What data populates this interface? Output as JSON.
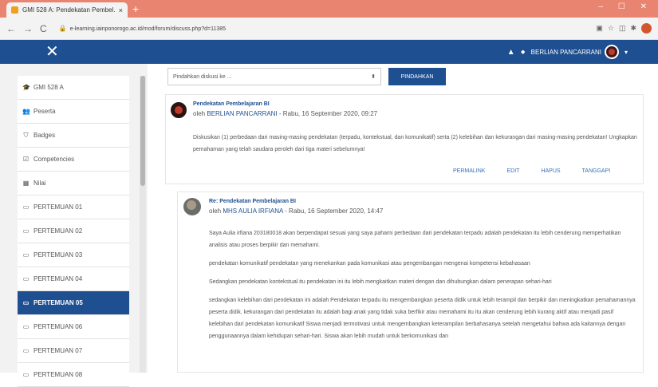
{
  "browser": {
    "tab_title": "GMI 528 A: Pendekatan Pembel...",
    "tab_close": "×",
    "new_tab": "+",
    "url": "e-learning.iainponorogo.ac.id/mod/forum/discuss.php?d=11385",
    "window_controls": "– ☐ ✕"
  },
  "navbar": {
    "menu_icon": "✕",
    "user_name": "BERLIAN PANCARRANI"
  },
  "sidebar": {
    "items": [
      {
        "label": "GMI 528 A",
        "icon": "mortarboard-icon"
      },
      {
        "label": "Peserta",
        "icon": "users-icon"
      },
      {
        "label": "Badges",
        "icon": "badge-icon"
      },
      {
        "label": "Competencies",
        "icon": "checklist-icon"
      },
      {
        "label": "Nilai",
        "icon": "table-icon"
      },
      {
        "label": "PERTEMUAN 01",
        "icon": "folder-icon"
      },
      {
        "label": "PERTEMUAN 02",
        "icon": "folder-icon"
      },
      {
        "label": "PERTEMUAN 03",
        "icon": "folder-icon"
      },
      {
        "label": "PERTEMUAN 04",
        "icon": "folder-icon"
      },
      {
        "label": "PERTEMUAN 05",
        "icon": "folder-icon",
        "active": true
      },
      {
        "label": "PERTEMUAN 06",
        "icon": "folder-icon"
      },
      {
        "label": "PERTEMUAN 07",
        "icon": "folder-icon"
      },
      {
        "label": "PERTEMUAN 08",
        "icon": "folder-icon"
      }
    ]
  },
  "move": {
    "select_value": "Pindahkan diskusi ke ...",
    "button": "PINDAHKAN"
  },
  "post1": {
    "subject": "Pendekatan Pembelajaran BI",
    "by": "oleh",
    "author": "BERLIAN PANCARRANI",
    "date": "- Rabu, 16 September 2020, 09:27",
    "body": "Diskusikan (1) perbedaan dari masing-masing pendekatan (terpadu, kontekstual, dan komunikatif) serta (2) kelebihan dan kekurangan dari masing-masing pendekatan! Ungkapkan pemahaman yang telah saudara peroleh dari tiga materi sebelumnya!",
    "actions": [
      "PERMALINK",
      "EDIT",
      "HAPUS",
      "TANGGAPI"
    ]
  },
  "post2": {
    "subject": "Re: Pendekatan Pembelajaran BI",
    "by": "oleh",
    "author": "MHS AULIA IRFIANA",
    "date": "- Rabu, 16 September 2020, 14:47",
    "paragraphs": [
      "Saya Aulia irfiana 203180018 akan berpendapat sesuai yang saya pahami perbedaan dari pendekatan terpadu adalah pendekatan itu lebih cenderung memperhatikan analisis atau proses berpikir dan memahami.",
      "pendekatan komunikatif pendekatan yang menekankan pada komunikasi atau pengembangan mengenai kompetensi kebahasaan",
      "Sedangkan pendekatan kontekstual itu pendekatan ini itu lebih mengkaitkan materi dengan dan dihubungkan dalam penerapan sehari-hari",
      "sedangkan kelebihan dari pendekatan ini adalah Pendekatan terpadu itu mengembangkan peserta didik untuk lebih terampil dan berpikir dan meningkatkan pemahamannya peserta didik. kekurangan dari pendekatan itu adalah bagi anak yang tidak suka berfikir atau memahami itu itu akan cenderung lebih kurang aktif atau menjadi pasif kelebihan dari pendekatan komunikatif Siswa menjadi termotivasi untuk mengembangkan keterampilan berbahasanya setelah mengetahui bahwa ada kaitannya dengan penggunaannya dalam kehidupan sehari-hari. Siswa akan lebih mudah untuk berkomunikasi dan"
    ]
  }
}
